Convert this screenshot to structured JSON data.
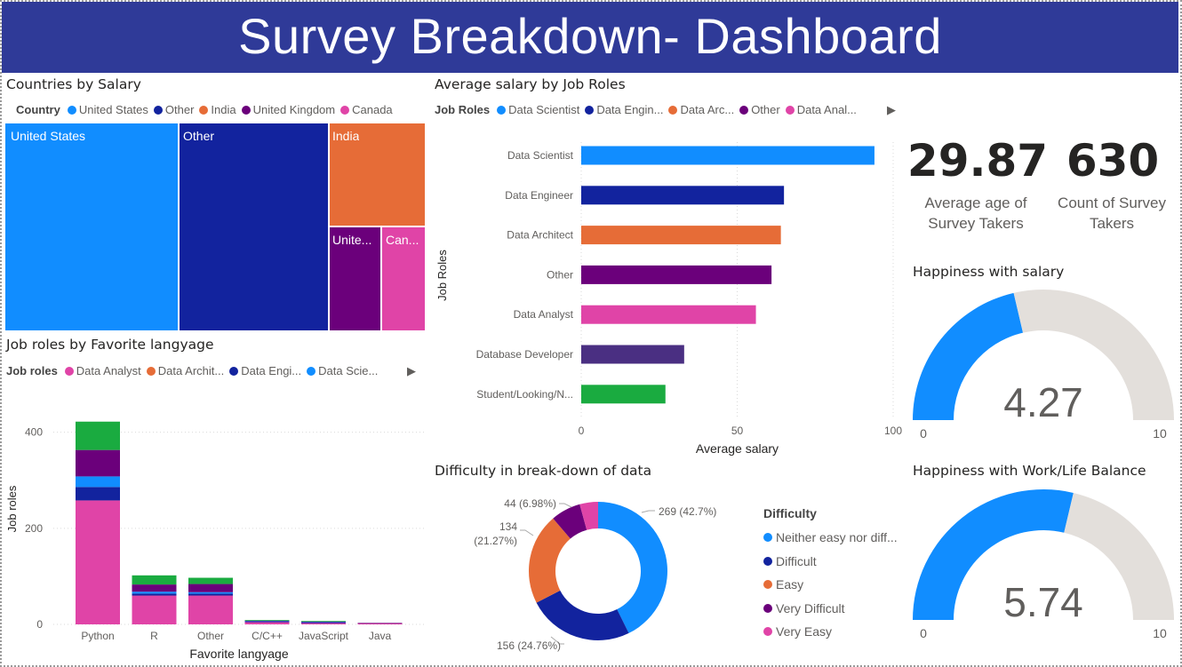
{
  "header": {
    "title": "Survey Breakdown- Dashboard"
  },
  "colors": {
    "header_bg": "#2f3a98",
    "united_states": "#118dff",
    "other": "#12239e",
    "india": "#e66c37",
    "united_kingdom": "#6b007b",
    "canada": "#e044a7",
    "dark_purple": "#4a2f82",
    "green": "#1aab40",
    "gauge_fill": "#118dff",
    "gauge_bg": "#e3dfdb"
  },
  "countries": {
    "title": "Countries by Salary",
    "legend_title": "Country",
    "legend": [
      "United States",
      "Other",
      "India",
      "United Kingdom",
      "Canada"
    ],
    "tiles": [
      "United States",
      "Other",
      "India",
      "Unite...",
      "Can..."
    ]
  },
  "job_salary": {
    "title": "Average salary by Job Roles",
    "legend_title": "Job Roles",
    "legend": [
      "Data Scientist",
      "Data Engin...",
      "Data Arc...",
      "Other",
      "Data Anal..."
    ],
    "ylabel": "Job Roles",
    "xlabel": "Average salary",
    "xticks": [
      "0",
      "50",
      "100"
    ]
  },
  "kpis": {
    "avg_age": {
      "value": "29.87",
      "label_line1": "Average age of",
      "label_line2": "Survey Takers"
    },
    "count": {
      "value": "630",
      "label_line1": "Count of Survey",
      "label_line2": "Takers"
    }
  },
  "gauge_salary": {
    "title": "Happiness with salary",
    "value": 4.27,
    "value_text": "4.27",
    "min": "0",
    "max": "10"
  },
  "gauge_balance": {
    "title": "Happiness with Work/Life Balance",
    "value": 5.74,
    "value_text": "5.74",
    "min": "0",
    "max": "10"
  },
  "language": {
    "title": "Job roles by Favorite langyage",
    "legend_title": "Job roles",
    "legend": [
      "Data Analyst",
      "Data Archit...",
      "Data Engi...",
      "Data Scie..."
    ],
    "ylabel": "Job roles",
    "xlabel": "Favorite langyage"
  },
  "difficulty": {
    "title": "Difficulty in break-down of data",
    "legend_title": "Difficulty",
    "legend": [
      "Neither easy nor diff...",
      "Difficult",
      "Easy",
      "Very Difficult",
      "Very Easy"
    ],
    "labels": [
      "269 (42.7%)",
      "156 (24.76%)",
      "134",
      "(21.27%)",
      "44 (6.98%)"
    ]
  },
  "chart_data": [
    {
      "type": "bar",
      "orientation": "horizontal",
      "title": "Average salary by Job Roles",
      "categories": [
        "Data Scientist",
        "Data Engineer",
        "Data Architect",
        "Other",
        "Data Analyst",
        "Database Developer",
        "Student/Looking/N..."
      ],
      "values": [
        94,
        65,
        64,
        61,
        56,
        33,
        27
      ],
      "bar_colors": [
        "#118dff",
        "#12239e",
        "#e66c37",
        "#6b007b",
        "#e044a7",
        "#4a2f82",
        "#1aab40"
      ],
      "xlabel": "Average salary",
      "ylabel": "Job Roles",
      "xlim": [
        0,
        100
      ],
      "xticks": [
        0,
        50,
        100
      ]
    },
    {
      "type": "bar",
      "stacked": true,
      "title": "Job roles by Favorite langyage",
      "categories": [
        "Python",
        "R",
        "Other",
        "C/C++",
        "JavaScript",
        "Java"
      ],
      "series": [
        {
          "name": "Data Analyst",
          "color": "#e044a7",
          "values": [
            258,
            60,
            60,
            5,
            3,
            2
          ]
        },
        {
          "name": "Data Engineer",
          "color": "#12239e",
          "values": [
            28,
            4,
            4,
            1,
            1,
            0
          ]
        },
        {
          "name": "Data Scientist",
          "color": "#118dff",
          "values": [
            22,
            4,
            3,
            1,
            1,
            0
          ]
        },
        {
          "name": "Other",
          "color": "#6b007b",
          "values": [
            55,
            15,
            17,
            1,
            1,
            1
          ]
        },
        {
          "name": "Student/Looking/None",
          "color": "#1aab40",
          "values": [
            59,
            19,
            13,
            1,
            1,
            0
          ]
        }
      ],
      "xlabel": "Favorite langyage",
      "ylabel": "Job roles",
      "ylim": [
        0,
        440
      ],
      "yticks": [
        0,
        200,
        400
      ]
    },
    {
      "type": "pie",
      "donut": true,
      "title": "Difficulty in break-down of data",
      "categories": [
        "Neither easy nor difficult",
        "Difficult",
        "Easy",
        "Very Difficult",
        "Very Easy"
      ],
      "values": [
        269,
        156,
        134,
        44,
        27
      ],
      "colors": [
        "#118dff",
        "#12239e",
        "#e66c37",
        "#6b007b",
        "#e044a7"
      ]
    }
  ]
}
